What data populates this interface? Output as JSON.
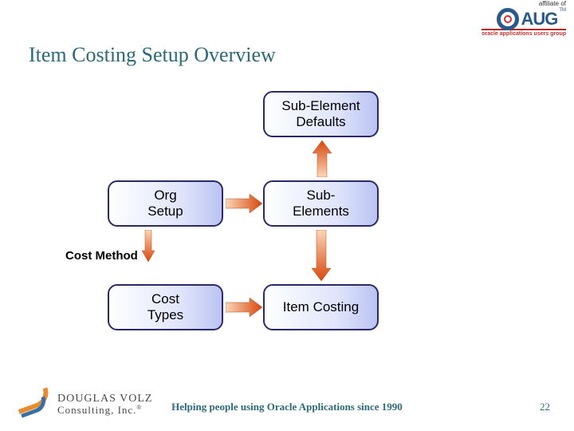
{
  "header_logo": {
    "affiliate_text": "affiliate of",
    "letters": "AUG",
    "tagline": "oracle applications users group",
    "tm": "TM"
  },
  "title": "Item Costing Setup Overview",
  "nodes": {
    "sub_element_defaults": "Sub-Element\nDefaults",
    "org_setup": "Org\nSetup",
    "sub_elements": "Sub-\nElements",
    "cost_types": "Cost\nTypes",
    "item_costing": "Item Costing"
  },
  "label_cost_method": "Cost Method",
  "footer": {
    "dv_line1": "DOUGLAS VOLZ",
    "dv_line2": "Consulting, Inc.",
    "reg": "®",
    "tagline": "Helping people using Oracle Applications since 1990",
    "page": "22"
  }
}
